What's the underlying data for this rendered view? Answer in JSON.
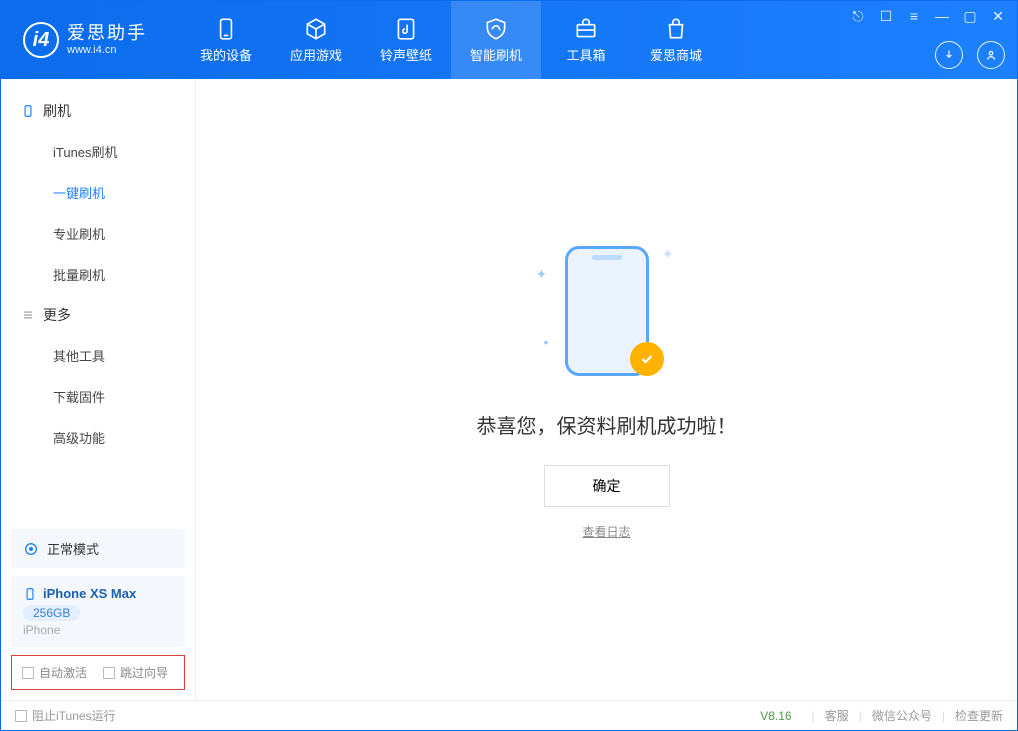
{
  "brand": {
    "name": "爱思助手",
    "sub": "www.i4.cn"
  },
  "nav": {
    "items": [
      {
        "label": "我的设备"
      },
      {
        "label": "应用游戏"
      },
      {
        "label": "铃声壁纸"
      },
      {
        "label": "智能刷机"
      },
      {
        "label": "工具箱"
      },
      {
        "label": "爱思商城"
      }
    ]
  },
  "sidebar": {
    "group1": {
      "title": "刷机",
      "items": [
        {
          "label": "iTunes刷机"
        },
        {
          "label": "一键刷机"
        },
        {
          "label": "专业刷机"
        },
        {
          "label": "批量刷机"
        }
      ]
    },
    "group2": {
      "title": "更多",
      "items": [
        {
          "label": "其他工具"
        },
        {
          "label": "下载固件"
        },
        {
          "label": "高级功能"
        }
      ]
    },
    "mode": "正常模式",
    "device": {
      "name": "iPhone XS Max",
      "storage": "256GB",
      "type": "iPhone"
    },
    "checks": {
      "auto_activate": "自动激活",
      "skip_wizard": "跳过向导"
    }
  },
  "main": {
    "message": "恭喜您，保资料刷机成功啦！",
    "ok": "确定",
    "view_log": "查看日志"
  },
  "status": {
    "block_itunes": "阻止iTunes运行",
    "version": "V8.16",
    "service": "客服",
    "wechat": "微信公众号",
    "update": "检查更新"
  }
}
